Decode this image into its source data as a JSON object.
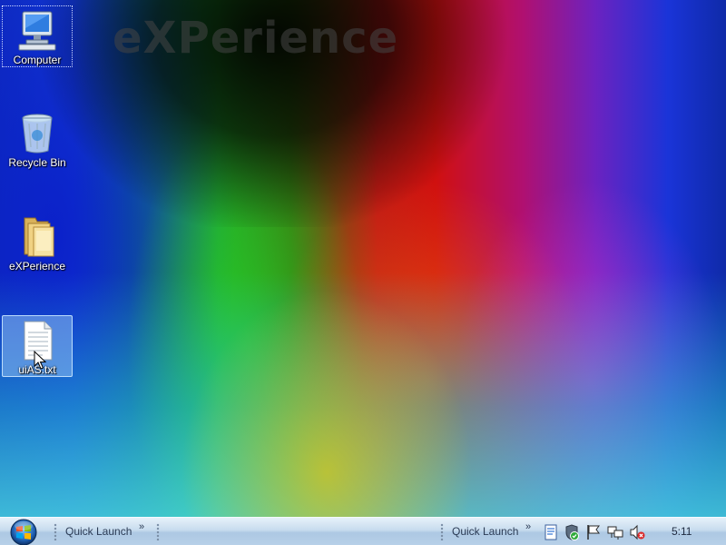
{
  "desktop": {
    "watermark": "eXPerience",
    "icons": [
      {
        "label": "Computer",
        "icon": "computer-icon",
        "selected": false,
        "focused": true
      },
      {
        "label": "Recycle Bin",
        "icon": "recycle-bin-icon",
        "selected": false
      },
      {
        "label": "eXPerience",
        "icon": "folder-icon",
        "selected": false
      },
      {
        "label": "uiAS.txt",
        "icon": "text-file-icon",
        "selected": true
      }
    ]
  },
  "taskbar": {
    "start_icon": "windows-orb-icon",
    "quick_launch_1": "Quick Launch",
    "quick_launch_2": "Quick Launch",
    "chevron": "»",
    "tray_icons": [
      "document-tray-icon",
      "security-shield-icon",
      "action-center-flag-icon",
      "network-icon",
      "volume-muted-icon"
    ],
    "clock": "5:11"
  },
  "colors": {
    "taskbar_top": "#e6f1fa",
    "taskbar_bottom": "#adc8e3",
    "selection": "#8cbef0"
  }
}
